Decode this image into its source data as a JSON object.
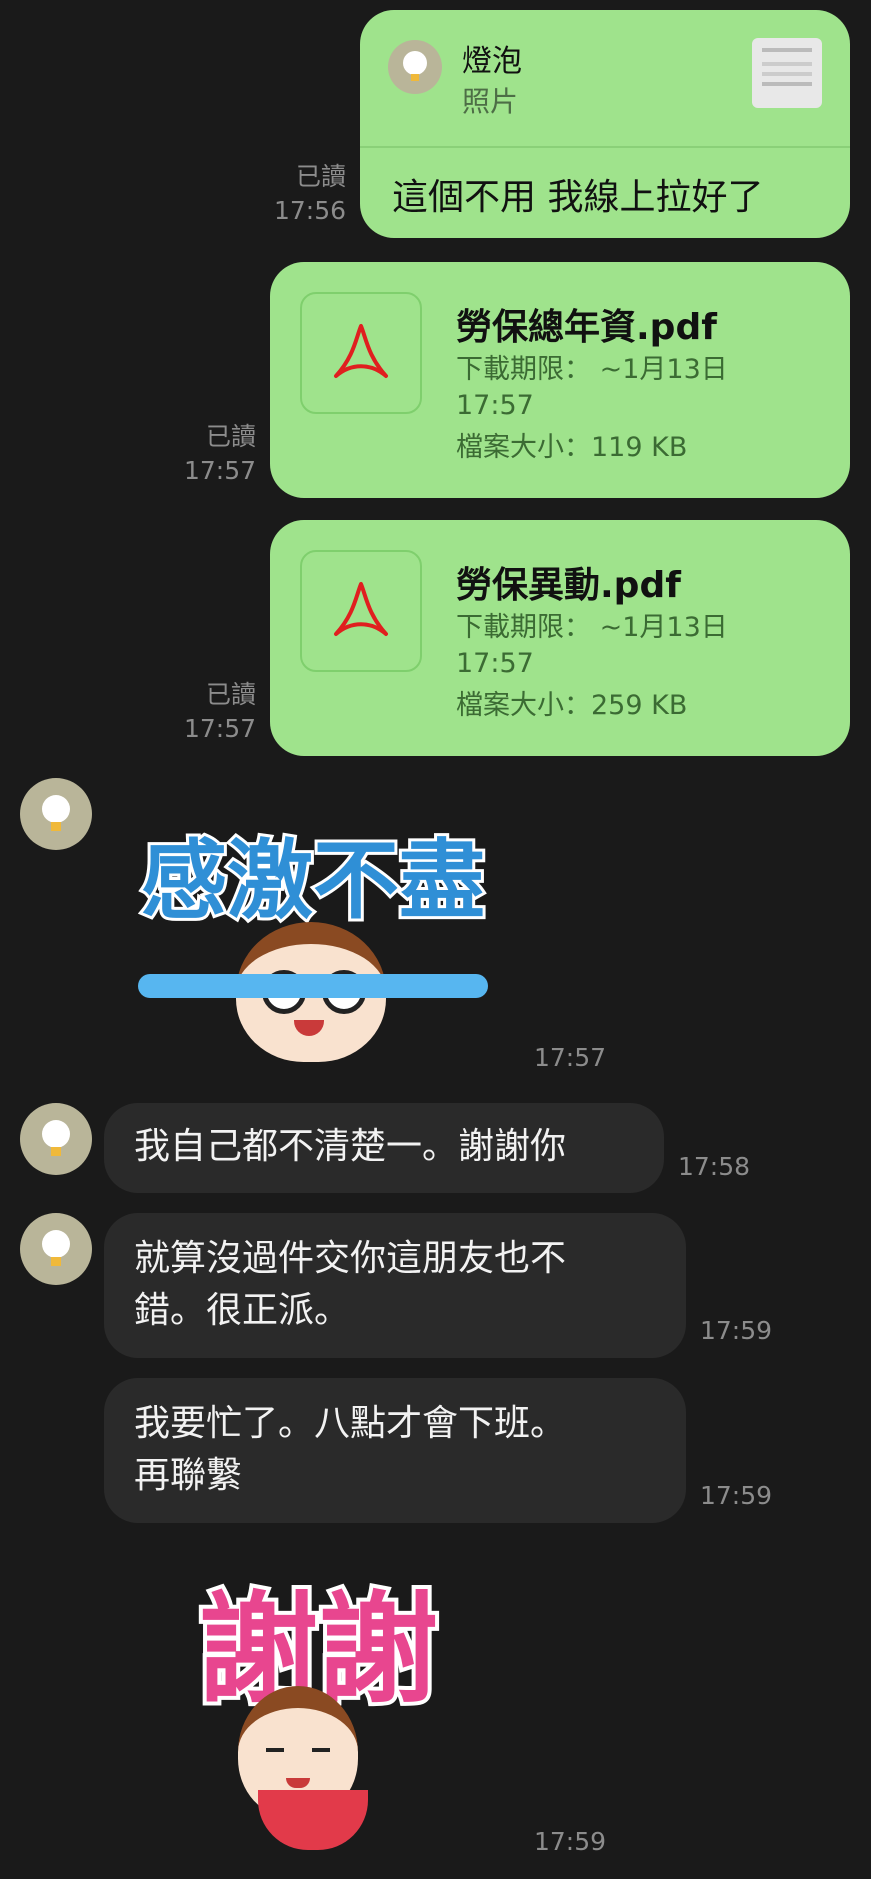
{
  "reply": {
    "sender": "燈泡",
    "type": "照片",
    "text": "這個不用 我線上拉好了",
    "read": "已讀",
    "time": "17:56"
  },
  "files": [
    {
      "name": "勞保總年資.pdf",
      "expiry_label": "下載期限：",
      "expiry_value": "~1月13日",
      "expiry_time": "17:57",
      "size": "檔案大小：119 KB",
      "read": "已讀",
      "time": "17:57"
    },
    {
      "name": "勞保異動.pdf",
      "expiry_label": "下載期限：",
      "expiry_value": "~1月13日",
      "expiry_time": "17:57",
      "size": "檔案大小：259 KB",
      "read": "已讀",
      "time": "17:57"
    }
  ],
  "sticker1": {
    "text": "感激不盡",
    "time": "17:57"
  },
  "incoming": [
    {
      "lines": [
        "我自己都不清楚一。謝謝你"
      ],
      "time": "17:58"
    },
    {
      "lines": [
        "就算沒過件交你這朋友也不",
        "錯。很正派。"
      ],
      "time": "17:59"
    },
    {
      "lines": [
        "我要忙了。八點才會下班。",
        "再聯繫"
      ],
      "time": "17:59"
    }
  ],
  "sticker2": {
    "text": "謝謝",
    "time": "17:59"
  },
  "colors": {
    "background": "#1a1a1a",
    "outgoing_bubble": "#9fe38c",
    "incoming_bubble": "#2a2a2a",
    "pdf_icon": "#e01f1f"
  }
}
